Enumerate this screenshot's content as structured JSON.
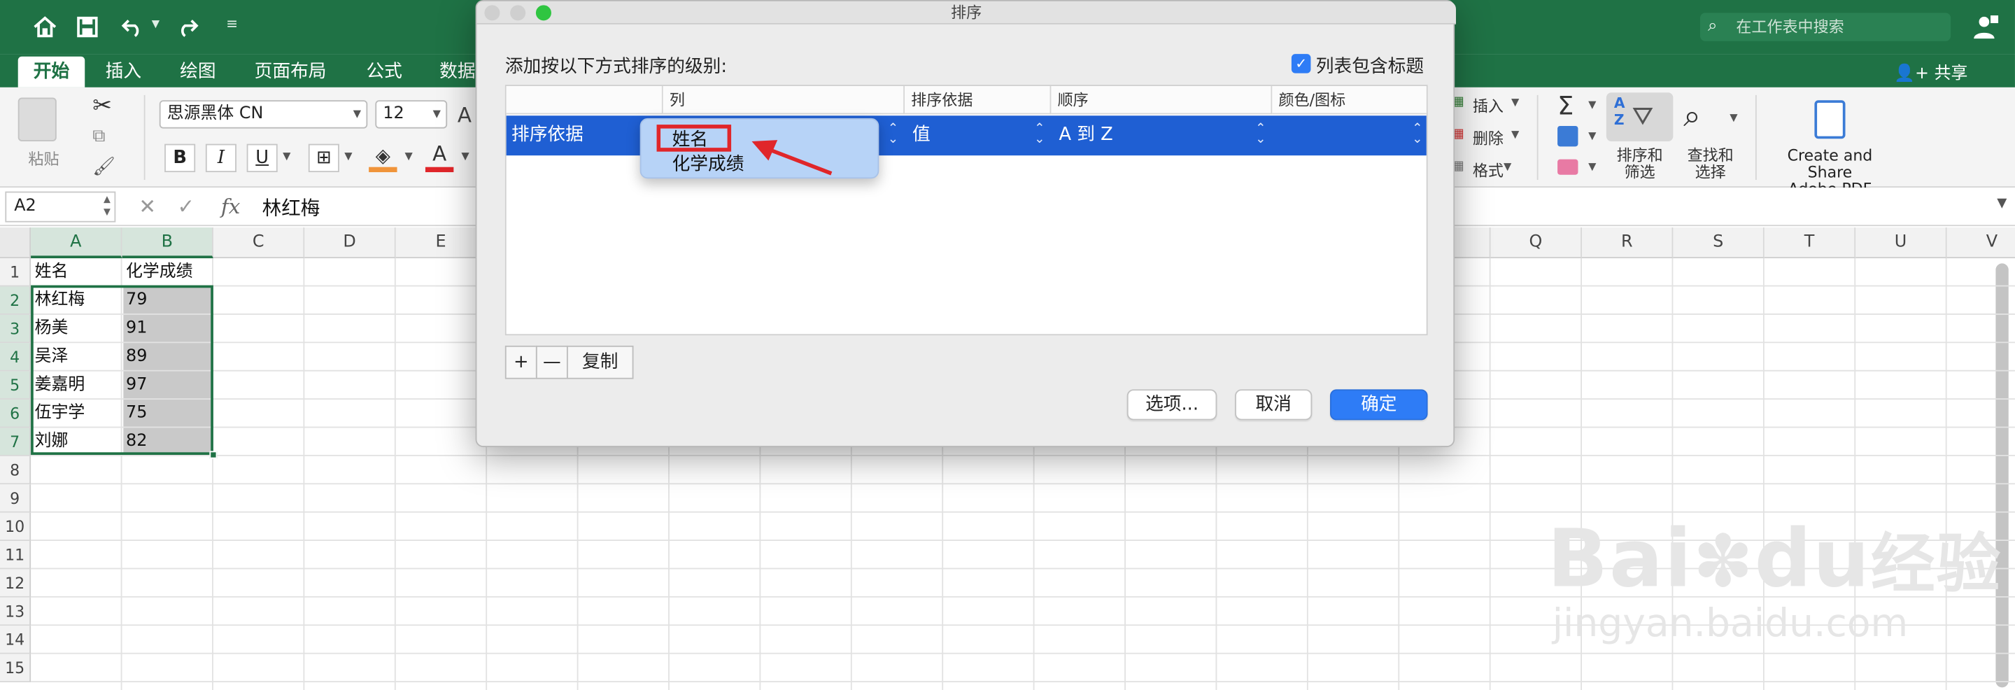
{
  "titlebar": {
    "search_placeholder": "在工作表中搜索",
    "share_label": "共享"
  },
  "ribbon_tabs": [
    "开始",
    "插入",
    "绘图",
    "页面布局",
    "公式",
    "数据"
  ],
  "ribbon": {
    "paste_label": "粘贴",
    "font_name": "思源黑体 CN",
    "font_size": "12",
    "bold": "B",
    "italic": "I",
    "underline": "U",
    "font_color_glyph": "A",
    "insert_label": "插入",
    "delete_label": "删除",
    "format_label": "格式",
    "sort_filter_label": "排序和\n筛选",
    "sort_filter_line1": "排序和",
    "sort_filter_line2": "筛选",
    "find_select_line1": "查找和",
    "find_select_line2": "选择",
    "adobe_line1": "Create and Share",
    "adobe_line2": "Adobe PDF"
  },
  "formula_bar": {
    "name_box": "A2",
    "fx": "fx",
    "value": "林红梅"
  },
  "sheet": {
    "columns": [
      "A",
      "B",
      "C",
      "D",
      "E",
      "",
      "",
      "",
      "",
      "",
      "",
      "",
      "",
      "",
      "",
      "",
      "Q",
      "R",
      "S",
      "T",
      "U",
      "V"
    ],
    "rows": [
      "1",
      "2",
      "3",
      "4",
      "5",
      "6",
      "7",
      "8",
      "9",
      "10",
      "11",
      "12",
      "13",
      "14",
      "15"
    ],
    "data": [
      [
        "姓名",
        "化学成绩"
      ],
      [
        "林红梅",
        "79"
      ],
      [
        "杨美",
        "91"
      ],
      [
        "吴泽",
        "89"
      ],
      [
        "姜嘉明",
        "97"
      ],
      [
        "伍宇学",
        "75"
      ],
      [
        "刘娜",
        "82"
      ]
    ]
  },
  "dialog": {
    "title": "排序",
    "instruction": "添加按以下方式排序的级别:",
    "header_checkbox_label": "列表包含标题",
    "columns": [
      "列",
      "排序依据",
      "顺序",
      "颜色/图标"
    ],
    "row": {
      "label": "排序依据",
      "sort_on": "值",
      "order": "A 到 Z"
    },
    "dropdown_options": [
      "姓名",
      "化学成绩"
    ],
    "add_button": "+",
    "remove_button": "—",
    "copy_button": "复制",
    "options_button": "选项...",
    "cancel_button": "取消",
    "ok_button": "确定",
    "checkbox_checked": true
  },
  "watermark": {
    "brand": "Bai",
    "brand2": "du",
    "cn": "经验",
    "url": "jingyan.baidu.com"
  },
  "colors": {
    "excel_green": "#1f7245",
    "selection_blue": "#1f5fd3",
    "button_blue": "#2e7cf6",
    "annotation_red": "#e0262a"
  }
}
